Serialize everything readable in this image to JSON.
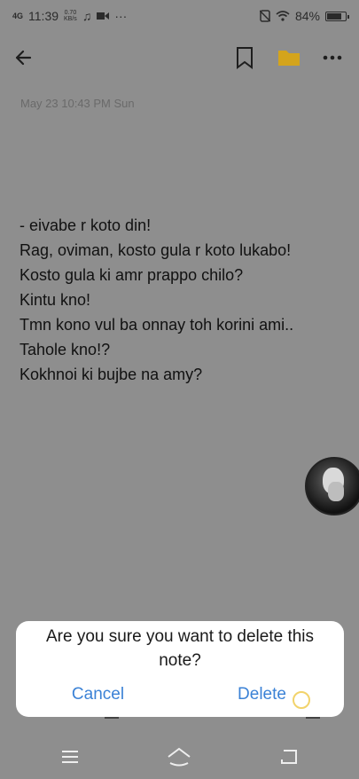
{
  "status_bar": {
    "signal_label": "4G",
    "time": "11:39",
    "net_speed_value": "0.70",
    "net_speed_unit": "KB/s",
    "battery_percent": "84%",
    "battery_level": 0.84,
    "icons": [
      "music-note-icon",
      "video-icon",
      "more-dots-icon",
      "no-sim-icon",
      "wifi-icon",
      "battery-icon"
    ]
  },
  "toolbar": {
    "icons": [
      "back-arrow-icon",
      "bookmark-icon",
      "folder-icon",
      "more-vert-icon"
    ],
    "folder_color": "#d4a41c"
  },
  "note": {
    "date": "May 23 10:43 PM Sun",
    "lines": [
      "- eivabe r koto din!",
      "Rag, oviman, kosto gula r koto lukabo!",
      "Kosto gula ki amr prappo chilo?",
      "Kintu kno!",
      "Tmn kono vul ba onnay toh korini ami..",
      "Tahole kno!?",
      "Kokhnoi ki bujbe na amy?"
    ]
  },
  "dialog": {
    "message": "Are you sure you want to delete this note?",
    "cancel_label": "Cancel",
    "delete_label": "Delete",
    "accent_color": "#3b82d6"
  },
  "nav_bar": {
    "icons": [
      "menu-icon",
      "home-icon",
      "back-icon"
    ]
  }
}
